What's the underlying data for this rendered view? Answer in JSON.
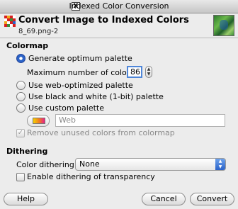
{
  "window": {
    "title": "Indexed Color Conversion",
    "x11_glyph": "X"
  },
  "header": {
    "title": "Convert Image to Indexed Colors",
    "subtitle": "8_69.png-2",
    "icon": "indexed-palette-icon"
  },
  "colormap": {
    "section_label": "Colormap",
    "options": {
      "optimum": "Generate optimum palette",
      "web": "Use web-optimized palette",
      "bw": "Use black and white (1-bit) palette",
      "custom": "Use custom palette"
    },
    "selected": "optimum",
    "max_colors_label": "Maximum number of colors:",
    "max_colors_value": "86",
    "custom_palette_name": "Web",
    "remove_unused_label": "Remove unused colors from colormap",
    "remove_unused_checked": true,
    "remove_unused_enabled": false
  },
  "dithering": {
    "section_label": "Dithering",
    "color_dithering_label": "Color dithering:",
    "color_dithering_value": "None",
    "transparency_label": "Enable dithering of transparency",
    "transparency_checked": false
  },
  "buttons": {
    "help": "Help",
    "cancel": "Cancel",
    "convert": "Convert"
  },
  "colors": {
    "accent": "#2b63c8",
    "window_bg": "#ececec"
  }
}
